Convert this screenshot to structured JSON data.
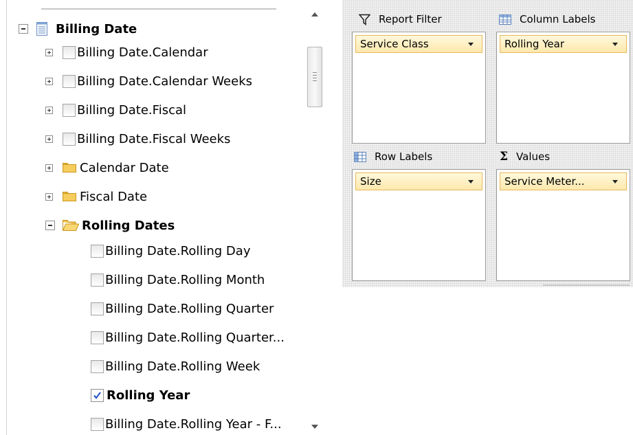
{
  "tree": {
    "root": {
      "label": "Billing Date",
      "icon": "dimension-table-icon"
    },
    "items": [
      {
        "label": "Billing Date.Calendar",
        "type": "hierarchy"
      },
      {
        "label": "Billing Date.Calendar Weeks",
        "type": "hierarchy"
      },
      {
        "label": "Billing Date.Fiscal",
        "type": "hierarchy"
      },
      {
        "label": "Billing Date.Fiscal Weeks",
        "type": "hierarchy"
      },
      {
        "label": "Calendar Date",
        "type": "folder"
      },
      {
        "label": "Fiscal Date",
        "type": "folder"
      }
    ],
    "open_folder": {
      "label": "Rolling Dates",
      "icon": "open-folder-icon"
    },
    "folder_items": [
      {
        "label": "Billing Date.Rolling Day",
        "checked": false
      },
      {
        "label": "Billing Date.Rolling Month",
        "checked": false
      },
      {
        "label": "Billing Date.Rolling Quarter",
        "checked": false
      },
      {
        "label": "Billing Date.Rolling Quarter...",
        "checked": false
      },
      {
        "label": "Billing Date.Rolling Week",
        "checked": false
      },
      {
        "label": "Rolling Year",
        "checked": true
      },
      {
        "label": "Billing Date.Rolling Year - F...",
        "checked": false
      }
    ]
  },
  "areas": {
    "report_filter": {
      "title": "Report Filter",
      "icon": "filter-icon",
      "field": "Service Class"
    },
    "column_labels": {
      "title": "Column Labels",
      "icon": "grid-icon",
      "field": "Rolling Year"
    },
    "row_labels": {
      "title": "Row Labels",
      "icon": "grid-icon",
      "field": "Size"
    },
    "values": {
      "title": "Values",
      "icon": "sigma-icon",
      "field": "Service Meter..."
    }
  },
  "colors": {
    "pill_border": "#e8b75a",
    "pill_fill": "#fde9ad",
    "folder": "#f2c94c"
  }
}
